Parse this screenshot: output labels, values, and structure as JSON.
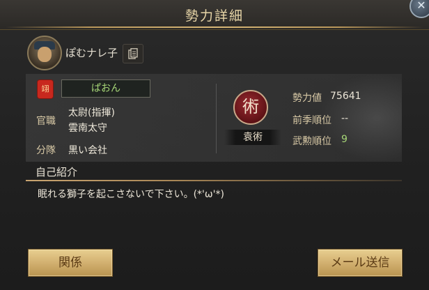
{
  "window": {
    "title": "勢力詳細"
  },
  "player": {
    "name": "ぽむナレ子"
  },
  "guild": {
    "flag_char": "翊",
    "name": "ぱおん"
  },
  "info": {
    "office_label": "官職",
    "office_lines": [
      "太尉(指揮)",
      "雲南太守"
    ],
    "squad_label": "分隊",
    "squad_value": "黒い会社"
  },
  "faction": {
    "emblem_char": "術",
    "name": "袁術"
  },
  "stats": {
    "power_label": "勢力値",
    "power_value": "75641",
    "prev_rank_label": "前季順位",
    "prev_rank_value": "--",
    "merit_rank_label": "武勲順位",
    "merit_rank_value": "9"
  },
  "intro": {
    "label": "自己紹介",
    "text": "眠れる獅子を起こさないで下さい。(*'ω'*)"
  },
  "buttons": {
    "relation": "関係",
    "send_mail": "メール送信"
  },
  "colors": {
    "accent_gold": "#d8b878",
    "green_value": "#a8d878",
    "emblem_red": "#8a1e24"
  }
}
